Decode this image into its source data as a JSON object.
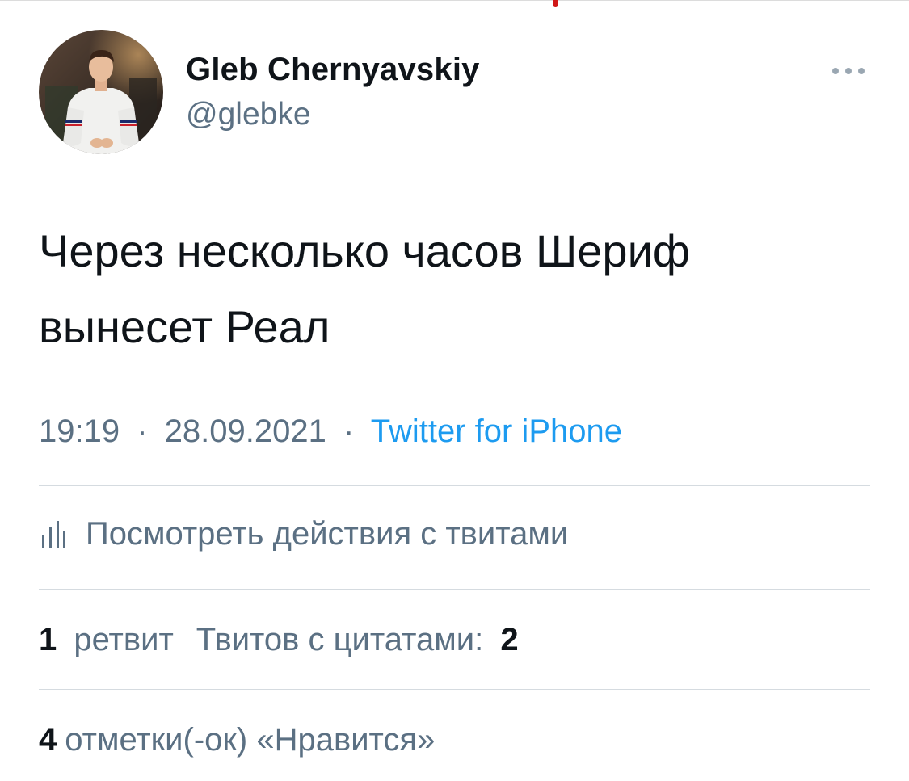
{
  "author": {
    "display_name": "Gleb Chernyavskiy",
    "handle": "@glebke"
  },
  "tweet": {
    "text_line1": "Через несколько часов Шериф",
    "text_line2": "вынесет Реал"
  },
  "meta": {
    "time": "19:19",
    "separator": "·",
    "date": "28.09.2021",
    "source": "Twitter for iPhone"
  },
  "activity": {
    "label": "Посмотреть действия с твитами",
    "icon": "analytics-bars-icon"
  },
  "stats": {
    "retweets_count": "1",
    "retweets_label": "ретвит",
    "quotes_label": "Твитов с цитатами:",
    "quotes_count": "2",
    "likes_count": "4",
    "likes_label": "отметки(-ок) «Нравится»"
  },
  "colors": {
    "text_primary": "#0f1419",
    "text_secondary": "#5b7083",
    "link": "#1d9bf0",
    "divider": "#d5dbe0"
  },
  "icons": {
    "more": "more-dots-icon"
  }
}
